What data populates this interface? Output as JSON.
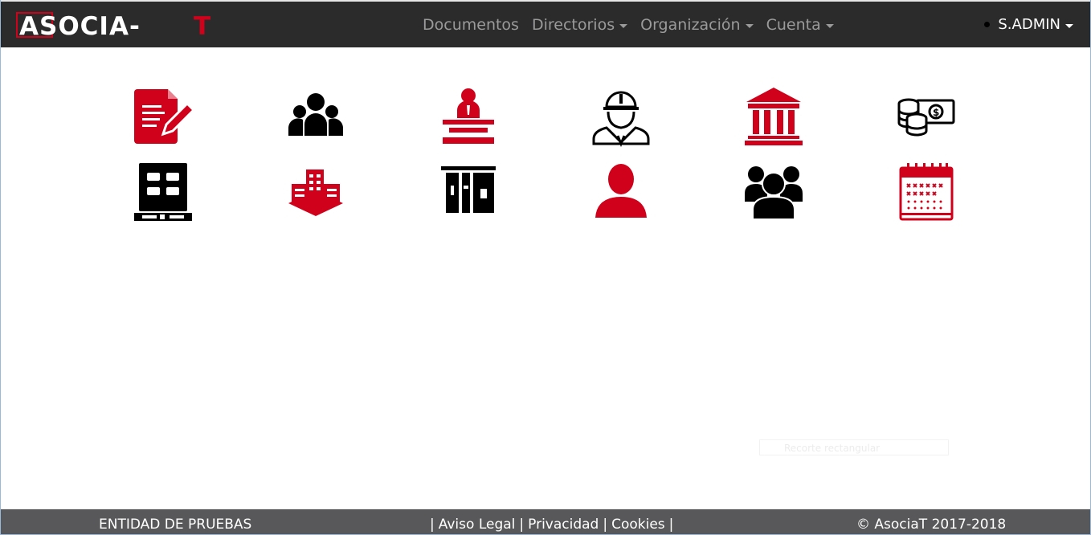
{
  "brand": {
    "logo_text": "ASOCIA-T",
    "accent": "#d0021b"
  },
  "nav": {
    "items": [
      {
        "label": "Documentos",
        "has_dropdown": false
      },
      {
        "label": "Directorios",
        "has_dropdown": true
      },
      {
        "label": "Organización",
        "has_dropdown": true
      },
      {
        "label": "Cuenta",
        "has_dropdown": true
      }
    ],
    "user": {
      "label": "S.ADMIN",
      "has_dropdown": true
    }
  },
  "tiles": [
    {
      "icon": "document-edit-icon",
      "color": "#d0021b"
    },
    {
      "icon": "group-icon",
      "color": "#000000"
    },
    {
      "icon": "speaker-podium-icon",
      "color": "#d0021b"
    },
    {
      "icon": "worker-helmet-icon",
      "color": "#000000"
    },
    {
      "icon": "bank-icon",
      "color": "#d0021b"
    },
    {
      "icon": "money-coins-icon",
      "color": "#000000"
    },
    {
      "icon": "office-building-icon",
      "color": "#000000"
    },
    {
      "icon": "company-building-icon",
      "color": "#d0021b"
    },
    {
      "icon": "facility-building-icon",
      "color": "#000000"
    },
    {
      "icon": "user-icon",
      "color": "#d0021b"
    },
    {
      "icon": "team-icon",
      "color": "#000000"
    },
    {
      "icon": "calendar-icon",
      "color": "#d0021b"
    }
  ],
  "ghost_field": {
    "text": "Recorte rectangular"
  },
  "footer": {
    "entity": "ENTIDAD DE PRUEBAS",
    "separator": "|",
    "links": [
      "Aviso Legal",
      "Privacidad",
      "Cookies"
    ],
    "copyright": "© AsociaT 2017-2018"
  }
}
